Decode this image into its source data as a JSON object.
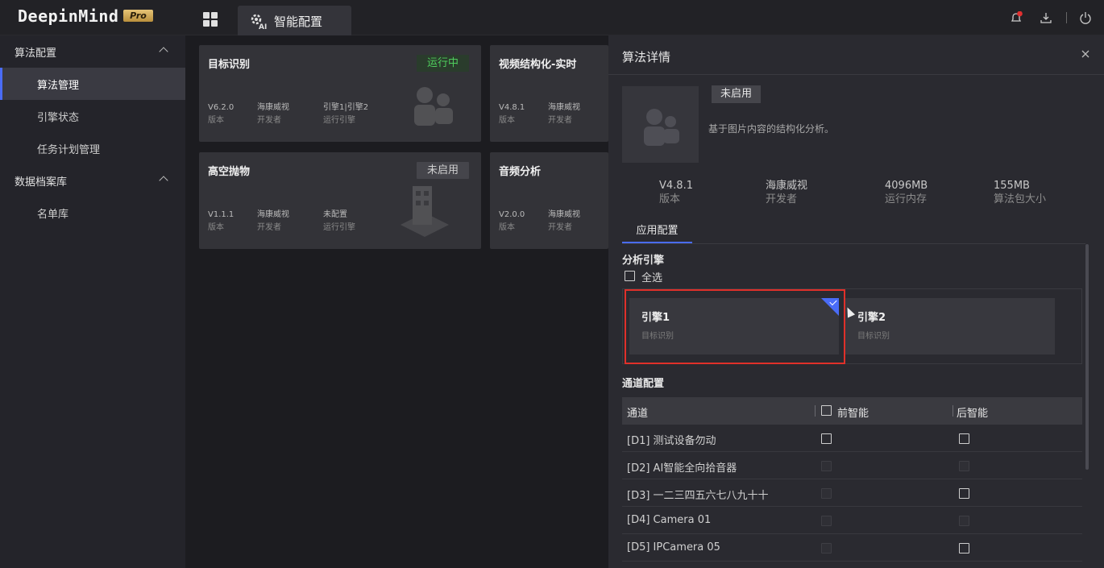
{
  "app": {
    "logo": "DeepinMind",
    "edition": "Pro"
  },
  "topbar": {
    "active_tab": "智能配置",
    "notification_badge": "..."
  },
  "sidebar": {
    "groups": [
      {
        "label": "算法配置",
        "items": [
          "算法管理",
          "引擎状态",
          "任务计划管理"
        ]
      },
      {
        "label": "数据档案库",
        "items": [
          "名单库"
        ]
      }
    ],
    "active_item": "算法管理"
  },
  "cards": [
    {
      "title": "目标识别",
      "status": "运行中",
      "version": "V6.2.0",
      "version_label": "版本",
      "developer": "海康威视",
      "developer_label": "开发者",
      "engine": "引擎1|引擎2",
      "engine_label": "运行引擎"
    },
    {
      "title": "视频结构化-实时",
      "version": "V4.8.1",
      "version_label": "版本",
      "developer": "海康威视",
      "developer_label": "开发者"
    },
    {
      "title": "高空抛物",
      "status": "未启用",
      "version": "V1.1.1",
      "version_label": "版本",
      "developer": "海康威视",
      "developer_label": "开发者",
      "engine": "未配置",
      "engine_label": "运行引擎"
    },
    {
      "title": "音频分析",
      "version": "V2.0.0",
      "version_label": "版本",
      "developer": "海康威视",
      "developer_label": "开发者"
    }
  ],
  "panel": {
    "title": "算法详情",
    "status": "未启用",
    "description": "基于图片内容的结构化分析。",
    "stats": [
      {
        "value": "V4.8.1",
        "label": "版本"
      },
      {
        "value": "海康威视",
        "label": "开发者"
      },
      {
        "value": "4096MB",
        "label": "运行内存"
      },
      {
        "value": "155MB",
        "label": "算法包大小"
      }
    ],
    "tab": "应用配置",
    "engine_section": "分析引擎",
    "select_all": "全选",
    "engines": [
      {
        "name": "引擎1",
        "sub": "目标识别",
        "selected": true
      },
      {
        "name": "引擎2",
        "sub": "目标识别",
        "selected": false
      }
    ],
    "channel_section": "通道配置",
    "table_headers": {
      "channel": "通道",
      "front": "前智能",
      "back": "后智能"
    },
    "rows": [
      {
        "name": "[D1] 测试设备勿动",
        "front": "enabled",
        "back": "enabled"
      },
      {
        "name": "[D2] AI智能全向拾音器",
        "front": "disabled",
        "back": "disabled"
      },
      {
        "name": "[D3] 一二三四五六七八九十十",
        "front": "disabled",
        "back": "enabled"
      },
      {
        "name": "[D4] Camera 01",
        "front": "disabled",
        "back": "disabled"
      },
      {
        "name": "[D5] IPCamera 05",
        "front": "disabled",
        "back": "enabled"
      }
    ]
  },
  "colors": {
    "accent": "#4a6cf7",
    "running": "#4fce5d",
    "highlight": "#e0302a"
  }
}
